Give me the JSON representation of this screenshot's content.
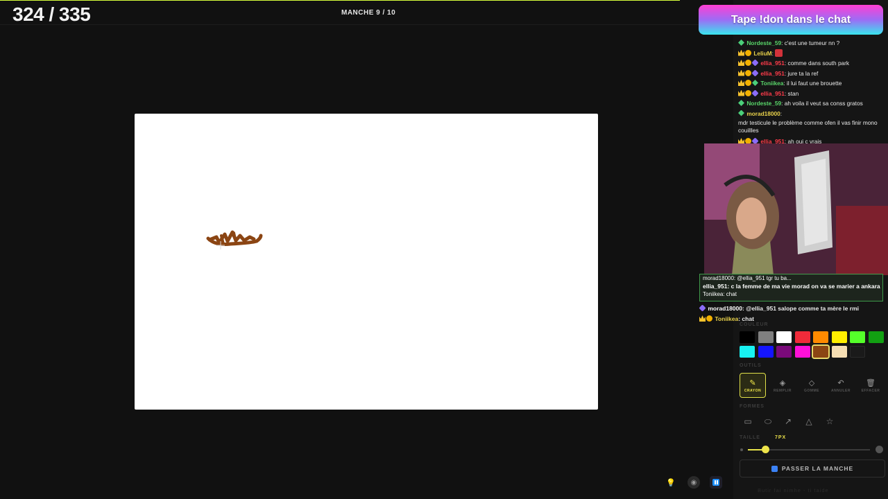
{
  "game": {
    "score": "324 / 335",
    "round": "MANCHE 9 / 10"
  },
  "banner": {
    "text": "Tape !don dans le chat"
  },
  "chat": [
    {
      "user": "Nordeste_59",
      "text": " c'est une tumeur nn ?",
      "user_color": "green"
    },
    {
      "user": "LeliuM",
      "text": "",
      "user_color": "yellow"
    },
    {
      "user": "ellia_951",
      "text": " comme dans south park",
      "user_color": "red"
    },
    {
      "user": "ellia_951",
      "text": " jure ta la ref",
      "user_color": "red"
    },
    {
      "user": "Toniikea",
      "text": " il lui faut une brouette",
      "user_color": "green"
    },
    {
      "user": "ellia_951",
      "text": " stan",
      "user_color": "red"
    },
    {
      "user": "Nordeste_59",
      "text": " ah voila il veut sa conss gratos",
      "user_color": "green"
    },
    {
      "user": "morad18000",
      "text": "",
      "user_color": "yellow"
    },
    {
      "user": "",
      "text": "mdr testicule le problème comme ofen il vas finir mono couillles",
      "user_color": ""
    },
    {
      "user": "ellia_951",
      "text": " ah oui c vrais",
      "user_color": "red"
    }
  ],
  "overlay_chat": {
    "line1": "morad18000: @ellia_951 tgr tu ba...",
    "line2": "ellia_951: c la femme de ma vie morad on va se marier a ankara",
    "line3": "Toniikea: chat"
  },
  "chat2": [
    {
      "user": "morad18000",
      "text": ": @ellia_951 salope comme ta mère le rmi",
      "user_color": "white"
    },
    {
      "user": "Toniikea",
      "text": ": chat",
      "user_color": "yellow"
    }
  ],
  "labels": {
    "colors": "COULEUR",
    "tools": "OUTILS",
    "shapes": "FORMES",
    "size": "TAILLE",
    "size_value": "7PX"
  },
  "palette": [
    "#000000",
    "#808080",
    "#ffffff",
    "#ef2b3a",
    "#ff8a00",
    "#ffee00",
    "#55ff2a",
    "#12a012",
    "#18f2f2",
    "#1515ff",
    "#7a0a7a",
    "#ff10d8",
    "#8b4513",
    "#f5deb3",
    "#1a1a1a"
  ],
  "selected_color": "#8b4513",
  "tools": [
    {
      "label": "CRAYON",
      "icon": "pencil-icon",
      "active": true
    },
    {
      "label": "REMPLIR",
      "icon": "fill-icon",
      "active": false
    },
    {
      "label": "GOMME",
      "icon": "eraser-icon",
      "active": false
    },
    {
      "label": "ANNULER",
      "icon": "undo-icon",
      "active": false
    },
    {
      "label": "EFFACER",
      "icon": "trash-icon",
      "active": false
    }
  ],
  "shapes": [
    "rectangle-icon",
    "ellipse-icon",
    "arrow-icon",
    "triangle-icon",
    "star-icon"
  ],
  "brush_size_fraction": 0.14,
  "pass_button": "PASSER LA MANCHE",
  "footer_hint": "Butir fai nimhe - ti taide"
}
